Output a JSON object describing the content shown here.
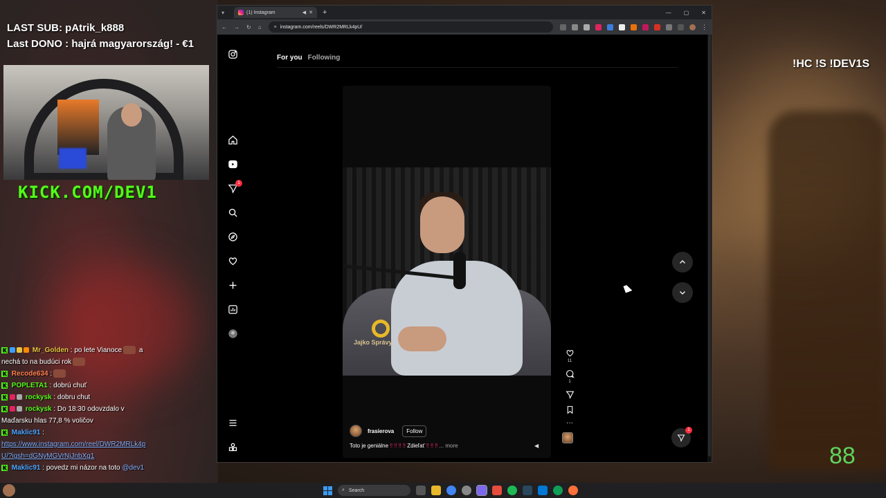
{
  "overlay": {
    "last_sub": "LAST SUB: pAtrik_k888",
    "last_dono": "Last DONO : hajrá magyarország! - €1",
    "kick_logo": "KICK.COM/DEV1",
    "right_tag": "!HC !S !DEV1S",
    "big_number": "88"
  },
  "chat": [
    {
      "user": "Mr_Golden",
      "user_color": "#e7c440",
      "text": ": po lete Vianoce",
      "cont": "a",
      "line2": "nechá to na budúci rok"
    },
    {
      "user": "Recode634",
      "user_color": "#ff7f50",
      "text": ":"
    },
    {
      "user": "POPLETA1",
      "user_color": "#53fc18",
      "text": ": dobrú chuť"
    },
    {
      "user": "rockysk",
      "user_color": "#53fc18",
      "text": ": dobru chut"
    },
    {
      "user": "rockysk",
      "user_color": "#53fc18",
      "text": ": Do 18:30 odovzdalo v",
      "line2": "Maďarsku hlas 77,8 % voličov"
    },
    {
      "user": "Maklic91",
      "user_color": "#4da6ff",
      "text": ":",
      "link1": "https://www.instagram.com/reel/DWR2MRLk4p",
      "link2": "U/?igsh=dGNyMGVrNjJnbXg1"
    },
    {
      "user": "Maklic91",
      "user_color": "#4da6ff",
      "text": ": povedz mi názor na toto",
      "mention": "@dev1"
    }
  ],
  "browser": {
    "tab_title": "(1) Instagram",
    "url": "instagram.com/reels/DWR2MRLk4pU/",
    "new_tab": "+",
    "window_controls": [
      "—",
      "▢",
      "✕"
    ]
  },
  "instagram": {
    "feed_tabs": [
      "For you",
      "Following"
    ],
    "sidebar_notification_count": "1",
    "reel": {
      "author": "frasierova",
      "follow_label": "Follow",
      "caption_text": "Toto je geniálne",
      "caption_marks": "‼ ‼ ‼ ‼",
      "caption_text2": "Zdieľať",
      "caption_marks2": "‼ ‼ ‼",
      "more_label": "... more",
      "video_logo_text": "Jajko Správy",
      "likes": "11",
      "comments": "1"
    },
    "dm_notification_count": "1"
  },
  "taskbar": {
    "search_placeholder": "Search"
  },
  "colors": {
    "kick_green": "#53fc18",
    "instagram_bg": "#000000",
    "notification_red": "#ff3040"
  }
}
